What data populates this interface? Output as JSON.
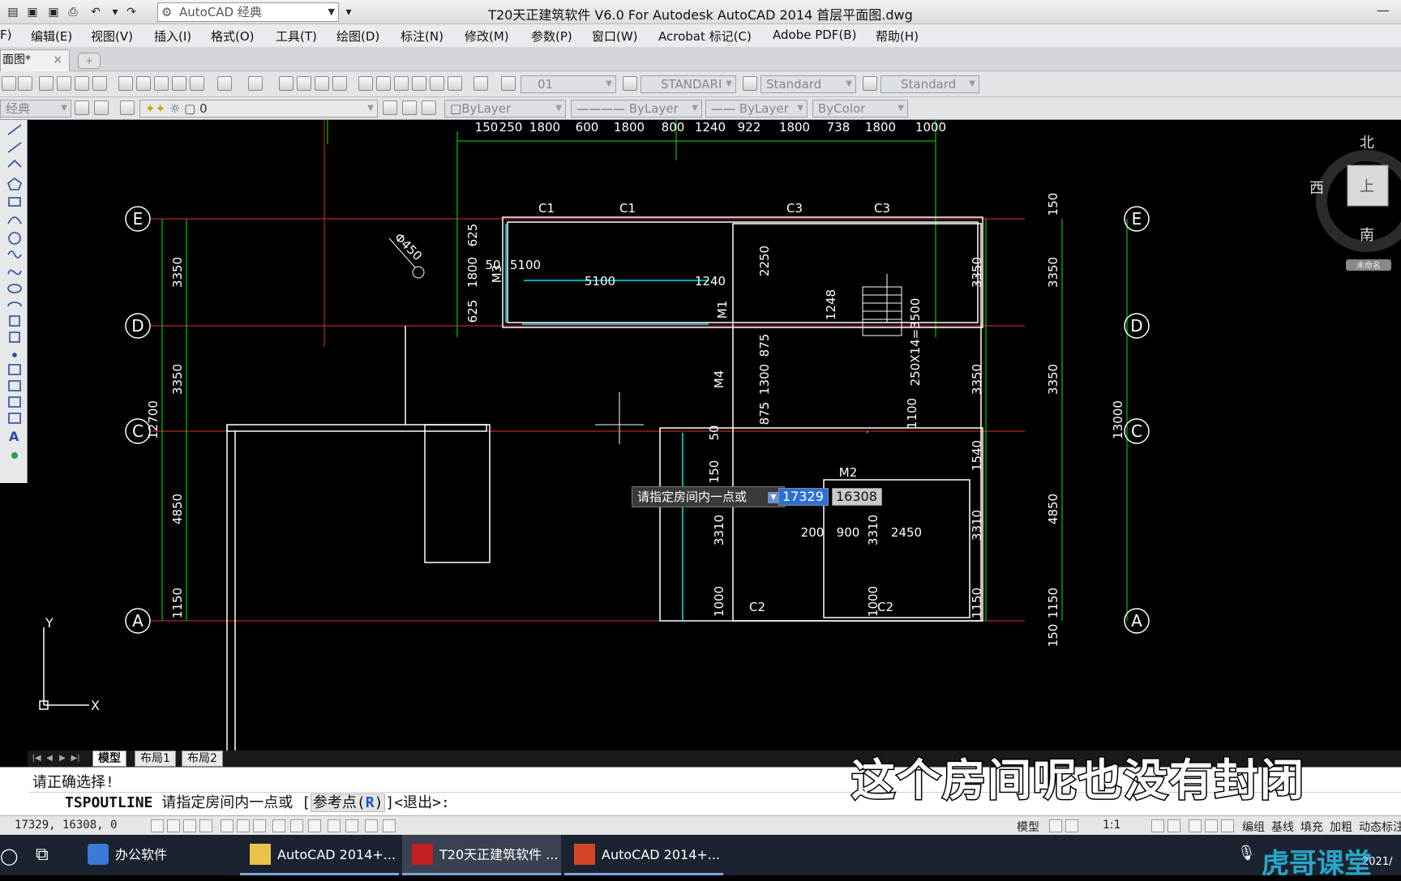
{
  "window": {
    "title": "T20天正建筑软件 V6.0 For Autodesk AutoCAD 2014    首层平面图.dwg",
    "workspace": "AutoCAD 经典"
  },
  "menu": [
    "F)",
    "编辑(E)",
    "视图(V)",
    "插入(I)",
    "格式(O)",
    "工具(T)",
    "绘图(D)",
    "标注(N)",
    "修改(M)",
    "参数(P)",
    "窗口(W)",
    "Acrobat 标记(C)",
    "Adobe PDF(B)",
    "帮助(H)"
  ],
  "doc_tab": {
    "label": "面图*",
    "close": "×",
    "new": "+"
  },
  "toolbar": {
    "text_style_value": "01",
    "dim_style": "STANDARI",
    "table_style": "Standard",
    "multileader_style": "Standard",
    "workspace_short": "经典",
    "layer_value": "0",
    "color": "ByLayer",
    "linetype": "ByLayer",
    "lineweight": "ByLayer",
    "plotstyle": "ByColor"
  },
  "viewcube": {
    "north": "北",
    "south": "南",
    "west": "西",
    "face": "上",
    "wcs": "未命名"
  },
  "tooltip": {
    "prompt": "请指定房间内一点或",
    "x_value": "17329",
    "y_value": "16308"
  },
  "layout_tabs": [
    "模型",
    "布局1",
    "布局2"
  ],
  "command": {
    "history": "请正确选择!",
    "name": "TSPOUTLINE",
    "prompt": "请指定房间内一点或",
    "bracket_open": "[",
    "option_text": "参考点(",
    "option_key": "R",
    "option_close": ")",
    "tail": "]<退出>:"
  },
  "status": {
    "coords": "17329, 16308, 0",
    "model": "模型",
    "scale": "1:1",
    "btn1": "编组",
    "btn2": "基线",
    "btn3": "填充",
    "btn4": "加粗",
    "btn5": "动态标注"
  },
  "taskbar": {
    "items": [
      "办公软件",
      "AutoCAD 2014+...",
      "T20天正建筑软件 ...",
      "AutoCAD 2014+..."
    ],
    "time": "2021/"
  },
  "subtitle": "这个房间呢也没有封闭",
  "watermark": "虎哥课堂",
  "drawing": {
    "axes_rows": [
      "E",
      "D",
      "C",
      "A"
    ],
    "top_dims": [
      "150",
      "250",
      "1800",
      "600",
      "1800",
      "800",
      "1240",
      "922",
      "1800",
      "738",
      "1800",
      "1000"
    ],
    "left_dims": [
      "3350",
      "3350",
      "4850",
      "1150"
    ],
    "left_total": "12700",
    "right_dims_inner": [
      "3350",
      "3350",
      "1540",
      "3310",
      "1150"
    ],
    "right_dims_outer": [
      "150",
      "3350",
      "3350",
      "4850",
      "1150",
      "150"
    ],
    "right_total": "13000",
    "labels": {
      "c1a": "C1",
      "c1b": "C1",
      "c3a": "C3",
      "c3b": "C3",
      "c2a": "C2",
      "c2b": "C2",
      "m1": "M1",
      "m2": "M2",
      "m3": "M3",
      "m4": "M4",
      "d5100": "5100",
      "d1240": "1240",
      "d2250": "2250",
      "d1248": "1248",
      "stair": "250X14=3500",
      "d875a": "875",
      "d1300": "1300",
      "d875b": "875",
      "d1100": "1100",
      "d625a": "625",
      "d1800": "1800",
      "d625b": "625",
      "d50": "50",
      "d5100b": "5100",
      "d150": "150",
      "d3310a": "3310",
      "d200": "200",
      "d900": "900",
      "d3310b": "3310",
      "d2450": "2450",
      "d1000a": "1000",
      "d1000b": "1000",
      "pipe": "Φ450",
      "d50b": "50"
    },
    "ucs_y": "Y",
    "ucs_x": "X"
  },
  "colors": {
    "grid": "#00ff00",
    "axis": "#ff2a2a",
    "wall": "#ffffff",
    "hatch": "#ff6060",
    "window": "#00ffff"
  }
}
